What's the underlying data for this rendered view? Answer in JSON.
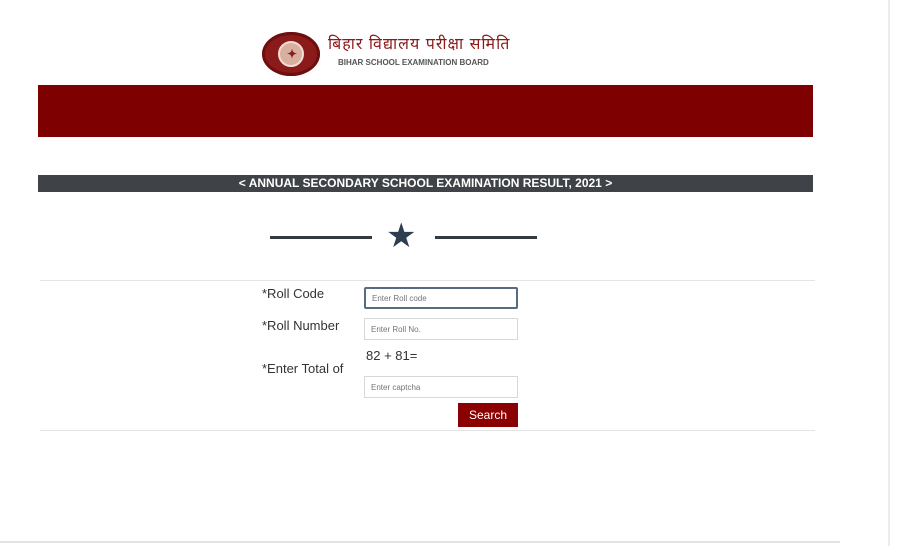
{
  "header": {
    "board_name_hindi": "बिहार विद्यालय परीक्षा समिति",
    "board_name_english": "BIHAR SCHOOL EXAMINATION BOARD"
  },
  "result_title": "< ANNUAL SECONDARY SCHOOL EXAMINATION RESULT, 2021 >",
  "form": {
    "roll_code_label": "*Roll Code",
    "roll_code_placeholder": "Enter Roll code",
    "roll_number_label": "*Roll Number",
    "roll_number_placeholder": "Enter Roll No.",
    "captcha_label": "*Enter Total of",
    "captcha_question": "82 + 81=",
    "captcha_placeholder": "Enter captcha",
    "search_label": "Search"
  },
  "colors": {
    "banner": "#7f0000",
    "title_bar": "#3f4247",
    "search_button": "#8b0000"
  },
  "icons": {
    "divider": "star-icon",
    "logo": "board-logo"
  }
}
